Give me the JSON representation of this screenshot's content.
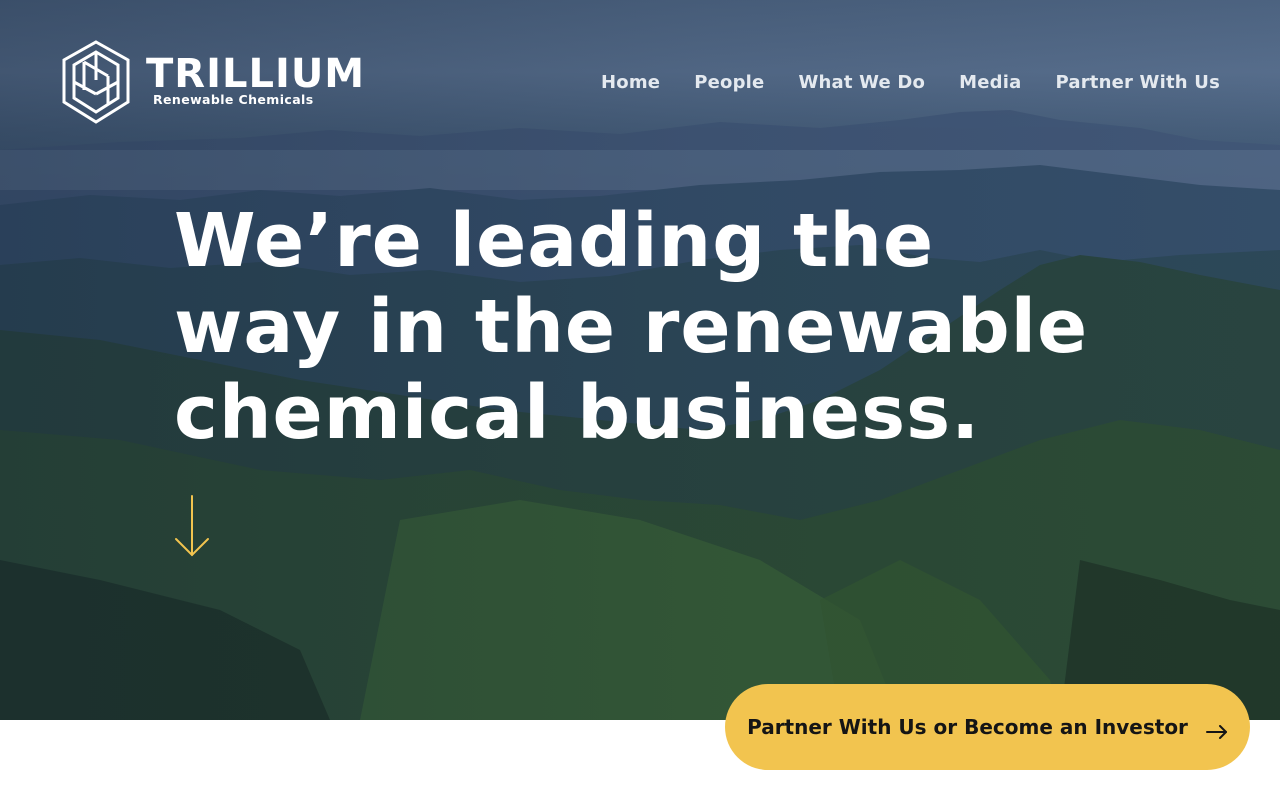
{
  "brand": {
    "name": "TRILLIUM",
    "tagline": "Renewable Chemicals",
    "logo_icon": "hexagon-mark-icon"
  },
  "nav": {
    "items": [
      {
        "label": "Home"
      },
      {
        "label": "People"
      },
      {
        "label": "What We Do"
      },
      {
        "label": "Media"
      },
      {
        "label": "Partner With Us"
      }
    ]
  },
  "hero": {
    "headline_lines": [
      "We’re leading the",
      "way in the renewable",
      "chemical business."
    ],
    "scroll_icon": "down-arrow-icon",
    "background": "forested-mountains-photo"
  },
  "cta": {
    "label": "Partner With Us or Become an Investor",
    "icon": "right-arrow-icon"
  },
  "colors": {
    "accent": "#f2c44f",
    "text_light": "#ffffff",
    "nav_text": "#e4e9ef",
    "cta_text": "#151515"
  }
}
